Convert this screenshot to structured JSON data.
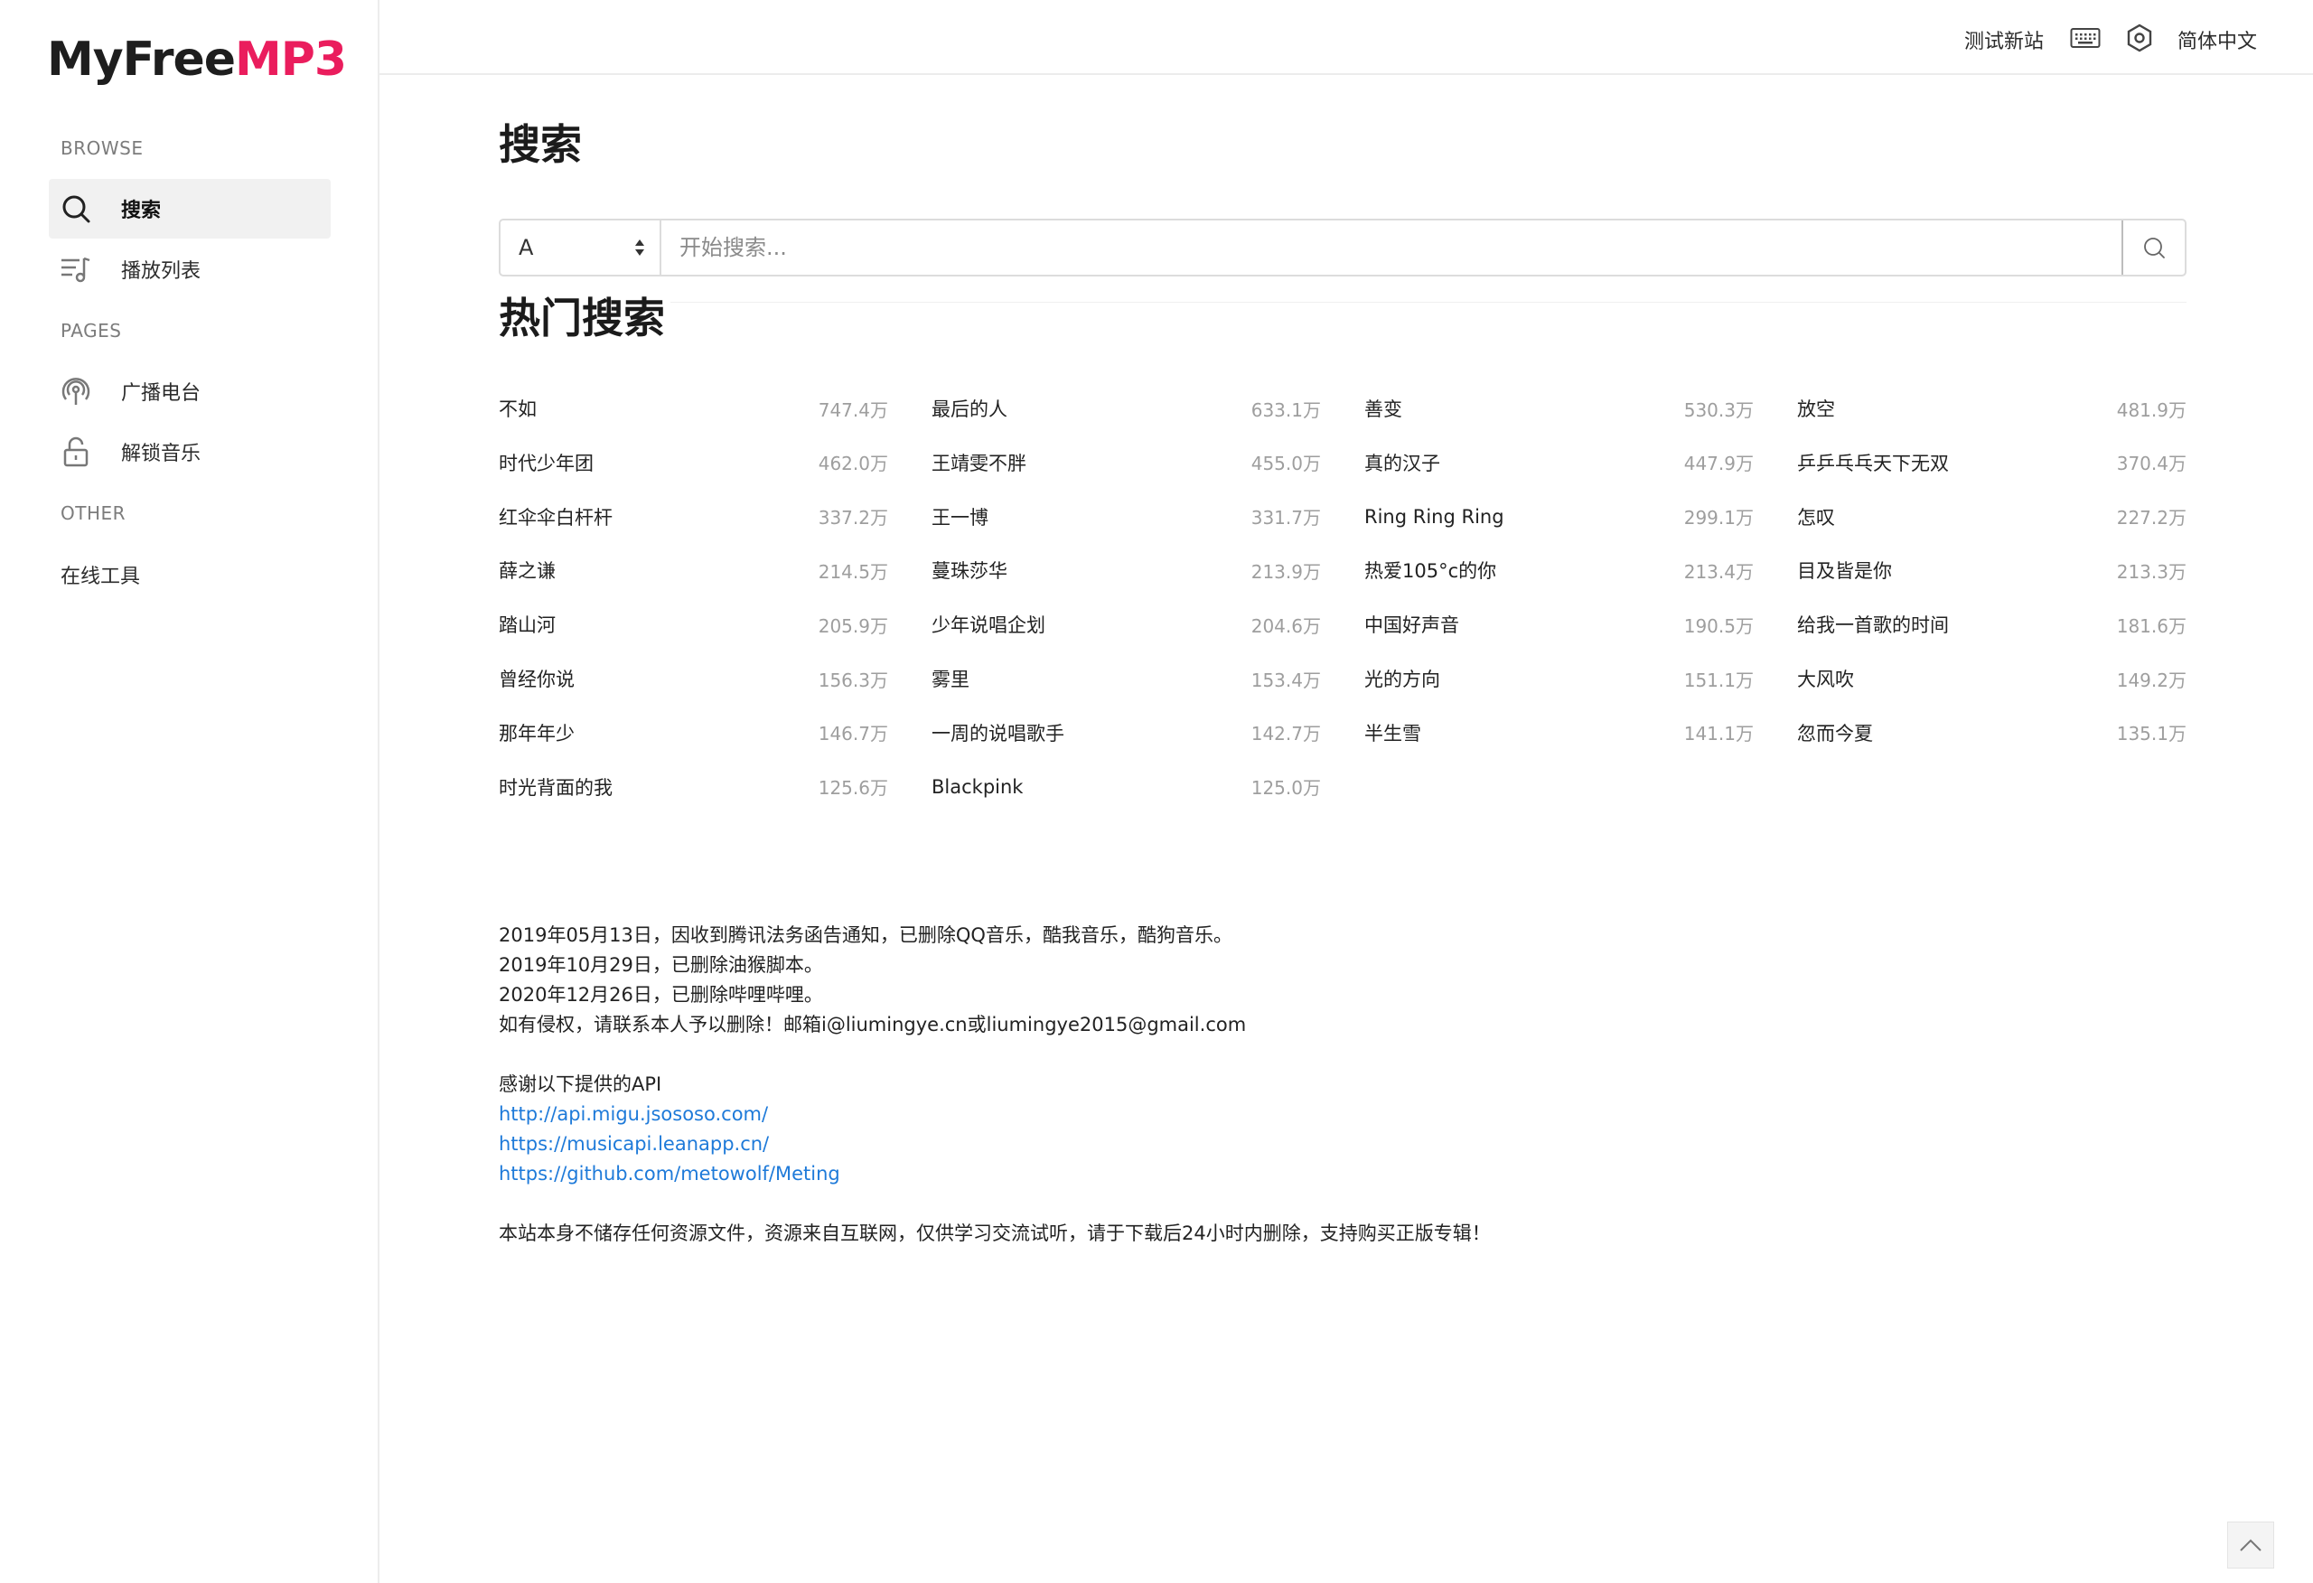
{
  "sidebar": {
    "logo_main": "MyFree",
    "logo_accent": "MP3",
    "section_browse": "BROWSE",
    "section_pages": "PAGES",
    "section_other": "OTHER",
    "items": [
      {
        "label": "搜索",
        "icon": "search-icon",
        "active": true
      },
      {
        "label": "播放列表",
        "icon": "playlist-icon",
        "active": false
      },
      {
        "label": "广播电台",
        "icon": "radio-icon",
        "active": false
      },
      {
        "label": "解锁音乐",
        "icon": "unlock-icon",
        "active": false
      }
    ],
    "other_item": "在线工具"
  },
  "topbar": {
    "test_site": "测试新站",
    "keyboard_icon": "keyboard-icon",
    "settings_icon": "settings-icon",
    "language": "简体中文"
  },
  "main": {
    "title": "搜索",
    "search": {
      "source_value": "A",
      "placeholder": "开始搜索..."
    },
    "hot_title": "热门搜索",
    "hot_items": [
      [
        {
          "name": "不如",
          "count": "747.4万"
        },
        {
          "name": "最后的人",
          "count": "633.1万"
        },
        {
          "name": "善变",
          "count": "530.3万"
        },
        {
          "name": "放空",
          "count": "481.9万"
        }
      ],
      [
        {
          "name": "时代少年团",
          "count": "462.0万"
        },
        {
          "name": "王靖雯不胖",
          "count": "455.0万"
        },
        {
          "name": "真的汉子",
          "count": "447.9万"
        },
        {
          "name": "乒乒乓乓天下无双",
          "count": "370.4万"
        }
      ],
      [
        {
          "name": "红伞伞白杆杆",
          "count": "337.2万"
        },
        {
          "name": "王一博",
          "count": "331.7万"
        },
        {
          "name": "Ring Ring Ring",
          "count": "299.1万"
        },
        {
          "name": "怎叹",
          "count": "227.2万"
        }
      ],
      [
        {
          "name": "薛之谦",
          "count": "214.5万"
        },
        {
          "name": "蔓珠莎华",
          "count": "213.9万"
        },
        {
          "name": "热爱105°c的你",
          "count": "213.4万"
        },
        {
          "name": "目及皆是你",
          "count": "213.3万"
        }
      ],
      [
        {
          "name": "踏山河",
          "count": "205.9万"
        },
        {
          "name": "少年说唱企划",
          "count": "204.6万"
        },
        {
          "name": "中国好声音",
          "count": "190.5万"
        },
        {
          "name": "给我一首歌的时间",
          "count": "181.6万"
        }
      ],
      [
        {
          "name": "曾经你说",
          "count": "156.3万"
        },
        {
          "name": "雾里",
          "count": "153.4万"
        },
        {
          "name": "光的方向",
          "count": "151.1万"
        },
        {
          "name": "大风吹",
          "count": "149.2万"
        }
      ],
      [
        {
          "name": "那年年少",
          "count": "146.7万"
        },
        {
          "name": "一周的说唱歌手",
          "count": "142.7万"
        },
        {
          "name": "半生雪",
          "count": "141.1万"
        },
        {
          "name": "忽而今夏",
          "count": "135.1万"
        }
      ],
      [
        {
          "name": "时光背面的我",
          "count": "125.6万"
        },
        {
          "name": "Blackpink",
          "count": "125.0万"
        }
      ]
    ],
    "notice": {
      "line1": "2019年05月13日，因收到腾讯法务函告通知，已删除QQ音乐，酷我音乐，酷狗音乐。",
      "line2": "2019年10月29日，已删除油猴脚本。",
      "line3": "2020年12月26日，已删除哔哩哔哩。",
      "line4": "如有侵权，请联系本人予以删除！邮箱i@liumingye.cn或liumingye2015@gmail.com",
      "thanks": "感谢以下提供的API",
      "links": [
        "http://api.migu.jsososo.com/",
        "https://musicapi.leanapp.cn/",
        "https://github.com/metowolf/Meting"
      ],
      "disclaimer": "本站本身不储存任何资源文件，资源来自互联网，仅供学习交流试听，请于下载后24小时内删除，支持购买正版专辑！"
    }
  },
  "colors": {
    "accent": "#ea1d5d",
    "link": "#1e7ad9",
    "count": "#9e9e9e"
  },
  "back_to_top_icon": "chevron-up-icon"
}
